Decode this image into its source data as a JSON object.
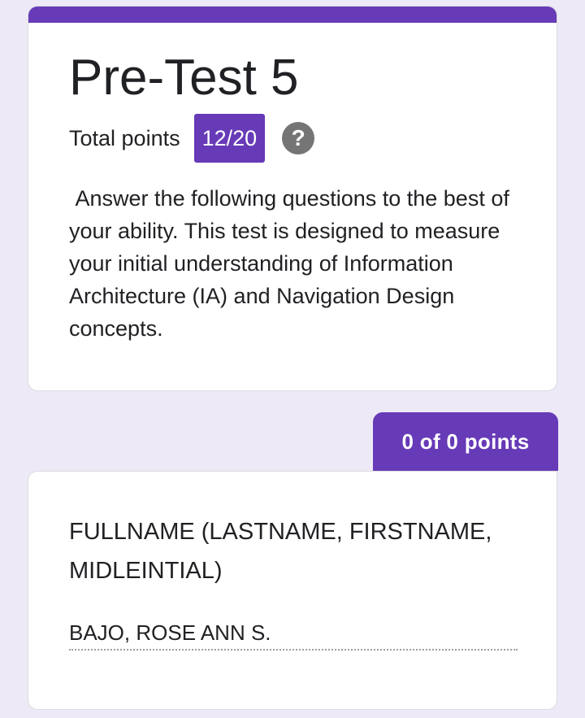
{
  "form": {
    "title": "Pre-Test 5",
    "total_points_label": "Total points",
    "score": "12/20",
    "help_icon": "question-mark-icon",
    "description": " Answer the following questions to the best of your ability. This test is designed to measure your initial understanding of Information Architecture (IA) and Navigation Design concepts.",
    "accent_color": "#673ab7",
    "background_color": "#ede9f7"
  },
  "question": {
    "points": "0 of 0 points",
    "title": "FULLNAME (LASTNAME, FIRSTNAME, MIDLEINTIAL)",
    "answer": "BAJO, ROSE ANN S."
  }
}
